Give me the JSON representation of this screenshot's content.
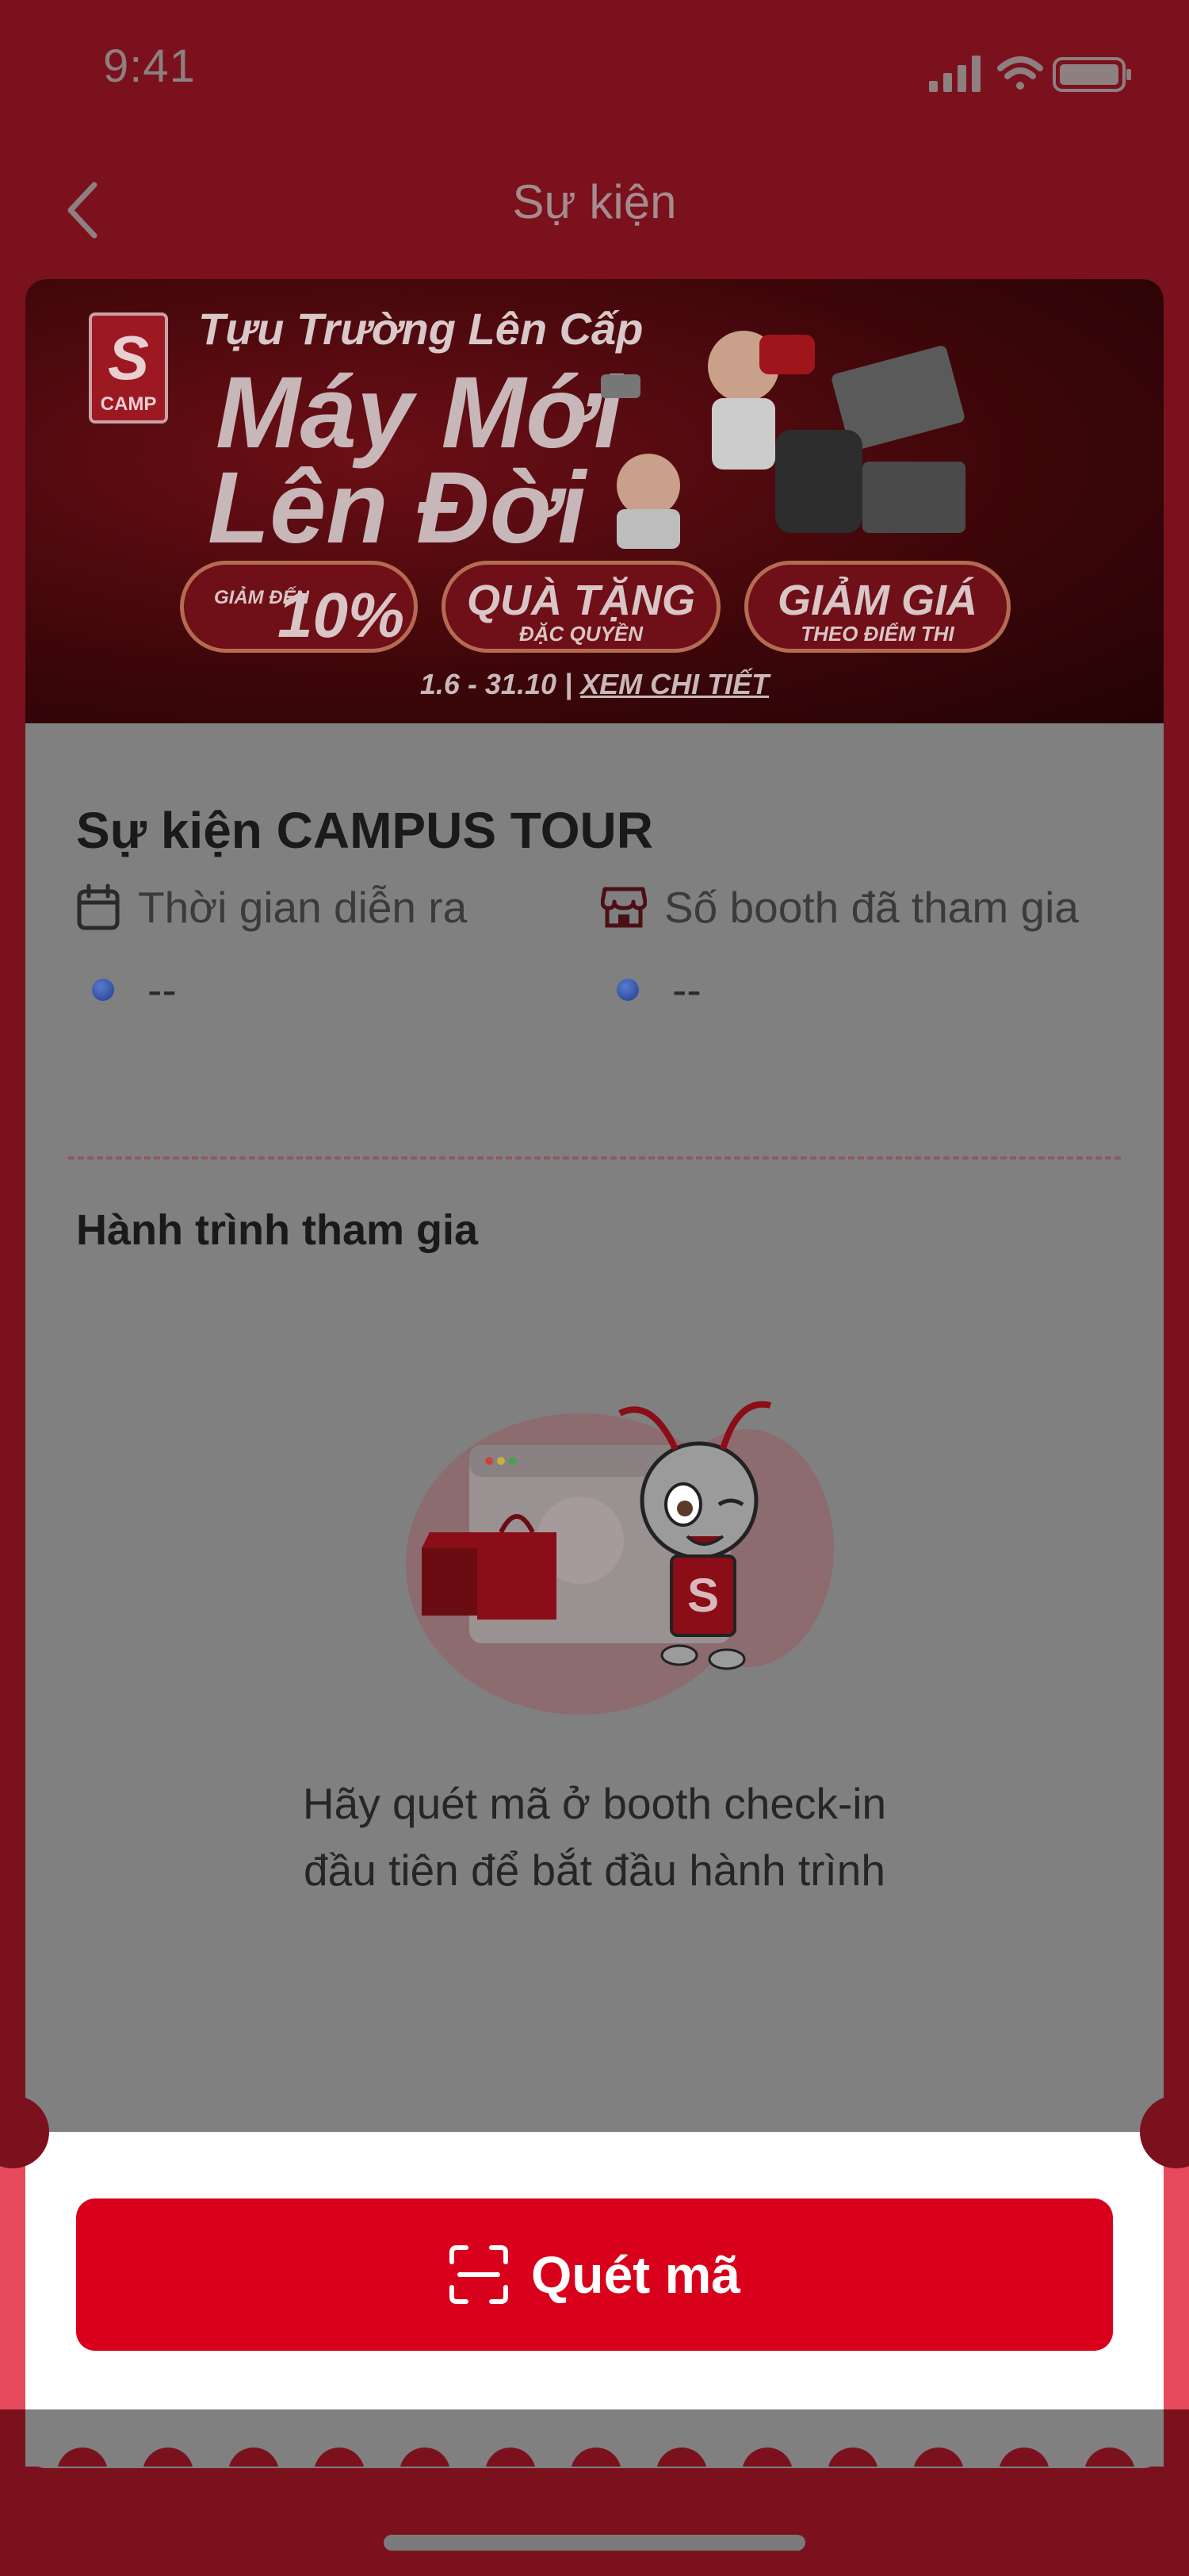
{
  "status_bar": {
    "time": "9:41"
  },
  "nav": {
    "title": "Sự kiện"
  },
  "banner": {
    "logo_letter": "S",
    "logo_text": "CAMP",
    "headline": "Tựu Trường Lên Cấp",
    "title_line1": "Máy Mới",
    "title_line2": "Lên Đời",
    "pill1_lead": "GIẢM ĐẾN",
    "pill1_big": "10%",
    "pill2_big": "QUÀ TẶNG",
    "pill2_small": "ĐẶC QUYỀN",
    "pill3_big": "GIẢM GIÁ",
    "pill3_small": "THEO ĐIỂM THI",
    "date": "1.6 - 31.10",
    "separator": "|",
    "link": "XEM CHI TIẾT"
  },
  "event": {
    "title": "Sự kiện CAMPUS TOUR",
    "time_label": "Thời gian diễn ra",
    "time_value": "--",
    "booth_label": "Số booth đã tham gia",
    "booth_value": "--"
  },
  "journey": {
    "title": "Hành trình tham gia",
    "empty_line1": "Hãy quét mã ở booth check-in",
    "empty_line2": "đầu tiên để bắt đầu hành trình"
  },
  "actions": {
    "scan_label": "Quét mã"
  },
  "colors": {
    "primary": "#d9001b",
    "backdrop": "#7b111d"
  }
}
